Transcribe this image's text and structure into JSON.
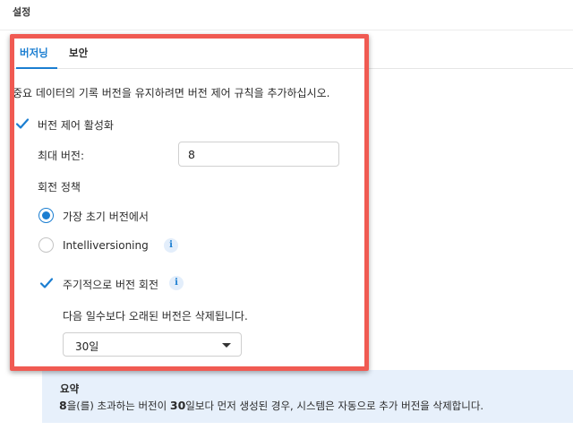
{
  "window": {
    "title": "설정"
  },
  "tabs": [
    {
      "label": "버저닝",
      "active": true
    },
    {
      "label": "보안",
      "active": false
    }
  ],
  "versioning": {
    "intro": "중요 데이터의 기록 버전을 유지하려면 버전 제어 규칙을 추가하십시오.",
    "enable_label": "버전 제어 활성화",
    "enable_checked": true,
    "max_versions_label": "최대 버전:",
    "max_versions_value": "8",
    "rotation_policy_label": "회전 정책",
    "radio_earliest_label": "가장 초기 버전에서",
    "radio_intelliversioning_label": "Intelliversioning",
    "selected_policy": "earliest",
    "periodic_label": "주기적으로 버전 회전",
    "periodic_checked": true,
    "delete_note": "다음 일수보다 오래된 버전은 삭제됩니다.",
    "days_selected": "30일"
  },
  "summary": {
    "title": "요약",
    "versions_num": "8",
    "part1": "을(를) 초과하는 버전이 ",
    "days_num": "30",
    "part2": "일보다 먼저 생성된 경우, 시스템은 자동으로 추가 버전을 삭제합니다."
  },
  "colors": {
    "accent": "#1b7ed1",
    "highlight_border": "#f05a52",
    "summary_bg": "#e7f0fb"
  },
  "icons": [
    "checkbox-check-icon",
    "info-icon",
    "chevron-down-icon"
  ]
}
